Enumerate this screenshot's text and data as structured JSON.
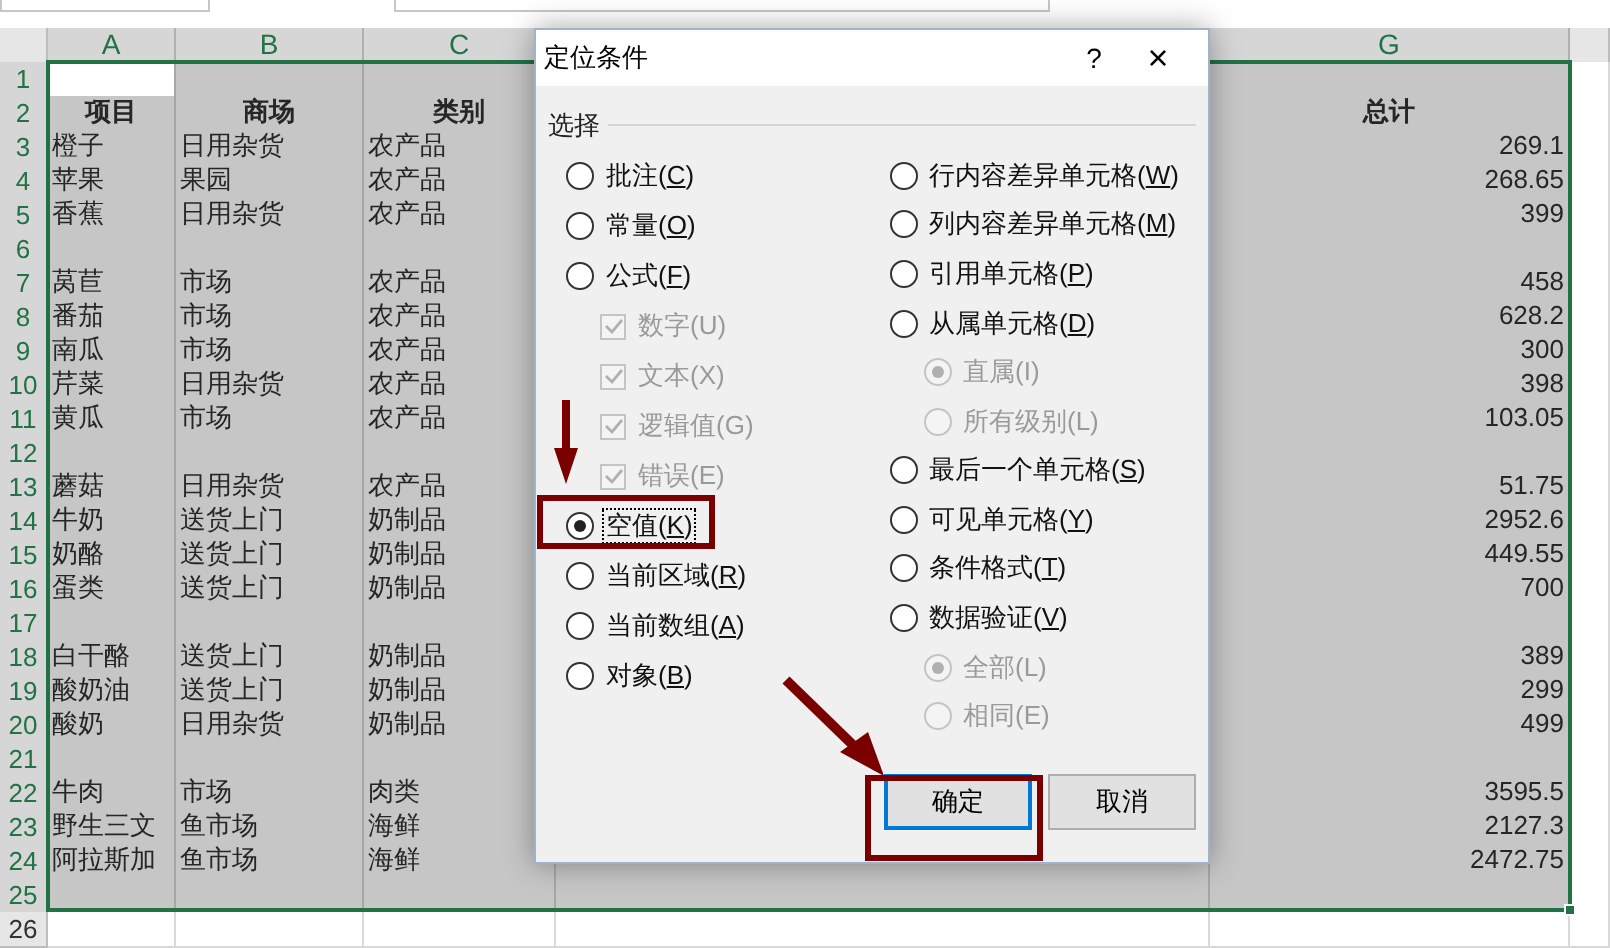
{
  "sheet": {
    "columns": [
      {
        "label": "A",
        "selected": true
      },
      {
        "label": "B",
        "selected": true
      },
      {
        "label": "C",
        "selected": true
      },
      {
        "label": "G",
        "selected": true
      }
    ],
    "rows": [
      {
        "number": "1",
        "selected": true,
        "active_first": true,
        "cells": [
          "",
          "",
          "",
          ""
        ]
      },
      {
        "number": "2",
        "selected": true,
        "header": true,
        "cells": [
          "项目",
          "商场",
          "类别",
          "总计"
        ]
      },
      {
        "number": "3",
        "selected": true,
        "cells": [
          "橙子",
          "日用杂货",
          "农产品",
          "269.1"
        ]
      },
      {
        "number": "4",
        "selected": true,
        "cells": [
          "苹果",
          "果园",
          "农产品",
          "268.65"
        ]
      },
      {
        "number": "5",
        "selected": true,
        "cells": [
          "香蕉",
          "日用杂货",
          "农产品",
          "399"
        ]
      },
      {
        "number": "6",
        "selected": true,
        "cells": [
          "",
          "",
          "",
          ""
        ]
      },
      {
        "number": "7",
        "selected": true,
        "cells": [
          "莴苣",
          "市场",
          "农产品",
          "458"
        ]
      },
      {
        "number": "8",
        "selected": true,
        "cells": [
          "番茄",
          "市场",
          "农产品",
          "628.2"
        ]
      },
      {
        "number": "9",
        "selected": true,
        "cells": [
          "南瓜",
          "市场",
          "农产品",
          "300"
        ]
      },
      {
        "number": "10",
        "selected": true,
        "cells": [
          "芹菜",
          "日用杂货",
          "农产品",
          "398"
        ]
      },
      {
        "number": "11",
        "selected": true,
        "cells": [
          "黄瓜",
          "市场",
          "农产品",
          "103.05"
        ]
      },
      {
        "number": "12",
        "selected": true,
        "cells": [
          "",
          "",
          "",
          ""
        ]
      },
      {
        "number": "13",
        "selected": true,
        "cells": [
          "蘑菇",
          "日用杂货",
          "农产品",
          "51.75"
        ]
      },
      {
        "number": "14",
        "selected": true,
        "cells": [
          "牛奶",
          "送货上门",
          "奶制品",
          "2952.6"
        ]
      },
      {
        "number": "15",
        "selected": true,
        "cells": [
          "奶酪",
          "送货上门",
          "奶制品",
          "449.55"
        ]
      },
      {
        "number": "16",
        "selected": true,
        "cells": [
          "蛋类",
          "送货上门",
          "奶制品",
          "700"
        ]
      },
      {
        "number": "17",
        "selected": true,
        "cells": [
          "",
          "",
          "",
          ""
        ]
      },
      {
        "number": "18",
        "selected": true,
        "cells": [
          "白干酪",
          "送货上门",
          "奶制品",
          "389"
        ]
      },
      {
        "number": "19",
        "selected": true,
        "cells": [
          "酸奶油",
          "送货上门",
          "奶制品",
          "299"
        ]
      },
      {
        "number": "20",
        "selected": true,
        "cells": [
          "酸奶",
          "日用杂货",
          "奶制品",
          "499"
        ]
      },
      {
        "number": "21",
        "selected": true,
        "cells": [
          "",
          "",
          "",
          ""
        ]
      },
      {
        "number": "22",
        "selected": true,
        "cells": [
          "牛肉",
          "市场",
          "肉类",
          "3595.5"
        ]
      },
      {
        "number": "23",
        "selected": true,
        "cells": [
          "野生三文",
          "鱼市场",
          "海鲜",
          "2127.3"
        ]
      },
      {
        "number": "24",
        "selected": true,
        "cells": [
          "阿拉斯加",
          "鱼市场",
          "海鲜",
          "2472.75"
        ]
      },
      {
        "number": "25",
        "selected": true,
        "cells": [
          "",
          "",
          "",
          ""
        ]
      },
      {
        "number": "26",
        "selected": false,
        "cells": [
          "",
          "",
          "",
          ""
        ]
      }
    ]
  },
  "dialog": {
    "title": "定位条件",
    "help": "?",
    "close": "×",
    "group": "选择",
    "left_options": [
      {
        "kind": "radio",
        "label": "批注(C)",
        "selected": false,
        "disabled": false
      },
      {
        "kind": "radio",
        "label": "常量(O)",
        "selected": false,
        "disabled": false
      },
      {
        "kind": "radio",
        "label": "公式(F)",
        "selected": false,
        "disabled": false,
        "children": [
          {
            "kind": "checkbox",
            "label": "数字(U)",
            "checked": true,
            "disabled": true
          },
          {
            "kind": "checkbox",
            "label": "文本(X)",
            "checked": true,
            "disabled": true
          },
          {
            "kind": "checkbox",
            "label": "逻辑值(G)",
            "checked": true,
            "disabled": true
          },
          {
            "kind": "checkbox",
            "label": "错误(E)",
            "checked": true,
            "disabled": true
          }
        ]
      },
      {
        "kind": "radio",
        "label": "空值(K)",
        "selected": true,
        "disabled": false,
        "focused": true
      },
      {
        "kind": "radio",
        "label": "当前区域(R)",
        "selected": false,
        "disabled": false
      },
      {
        "kind": "radio",
        "label": "当前数组(A)",
        "selected": false,
        "disabled": false
      },
      {
        "kind": "radio",
        "label": "对象(B)",
        "selected": false,
        "disabled": false
      }
    ],
    "right_options": [
      {
        "kind": "radio",
        "label": "行内容差异单元格(W)",
        "selected": false,
        "disabled": false
      },
      {
        "kind": "radio",
        "label": "列内容差异单元格(M)",
        "selected": false,
        "disabled": false
      },
      {
        "kind": "radio",
        "label": "引用单元格(P)",
        "selected": false,
        "disabled": false
      },
      {
        "kind": "radio",
        "label": "从属单元格(D)",
        "selected": false,
        "disabled": false,
        "children": [
          {
            "kind": "radio",
            "label": "直属(I)",
            "selected": true,
            "disabled": true
          },
          {
            "kind": "radio",
            "label": "所有级别(L)",
            "selected": false,
            "disabled": true
          }
        ]
      },
      {
        "kind": "radio",
        "label": "最后一个单元格(S)",
        "selected": false,
        "disabled": false
      },
      {
        "kind": "radio",
        "label": "可见单元格(Y)",
        "selected": false,
        "disabled": false
      },
      {
        "kind": "radio",
        "label": "条件格式(T)",
        "selected": false,
        "disabled": false
      },
      {
        "kind": "radio",
        "label": "数据验证(V)",
        "selected": false,
        "disabled": false,
        "children": [
          {
            "kind": "radio",
            "label": "全部(L)",
            "selected": true,
            "disabled": true
          },
          {
            "kind": "radio",
            "label": "相同(E)",
            "selected": false,
            "disabled": true
          }
        ]
      }
    ],
    "buttons": [
      {
        "label": "确定",
        "default": true
      },
      {
        "label": "取消",
        "default": false
      }
    ]
  }
}
